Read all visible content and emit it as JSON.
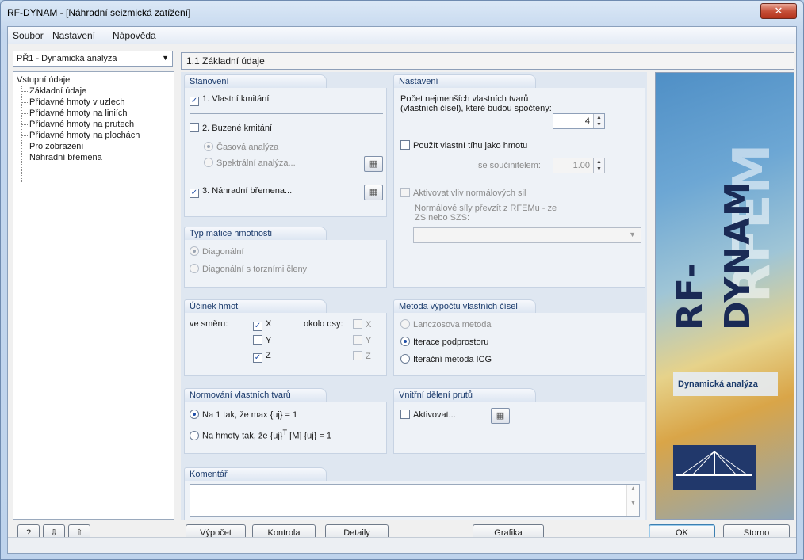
{
  "window": {
    "title": "RF-DYNAM - [Náhradní seizmická zatížení]",
    "close_glyph": "✕"
  },
  "menu": [
    "Soubor",
    "Nastavení",
    "Nápověda"
  ],
  "case_combo": "PŘ1 - Dynamická analýza",
  "tree": {
    "root": "Vstupní údaje",
    "items": [
      "Základní údaje",
      "Přídavné hmoty v uzlech",
      "Přídavné hmoty na liniích",
      "Přídavné hmoty na prutech",
      "Přídavné hmoty na plochách",
      "Pro zobrazení",
      "Náhradní břemena"
    ]
  },
  "section_header": "1.1 Základní údaje",
  "stanoveni": {
    "title": "Stanovení",
    "vlastni_kmitani": "1. Vlastní kmitání",
    "buzene_kmitani": "2. Buzené kmitání",
    "casova": "Časová analýza",
    "spektralni": "Spektrální analýza...",
    "nahradni": "3. Náhradní břemena..."
  },
  "typ_matice": {
    "title": "Typ matice hmotnosti",
    "diagonalni": "Diagonální",
    "diagonalni_torzni": "Diagonální s torzními členy"
  },
  "ucinek": {
    "title": "Účinek hmot",
    "ve_smeru": "ve směru:",
    "okolo_osy": "okolo osy:",
    "x": "X",
    "y": "Y",
    "z": "Z"
  },
  "normovani": {
    "title": "Normování vlastních tvarů",
    "opt1": "Na 1 tak, že max {uj} = 1",
    "opt2_a": "Na hmoty tak, že {uj}",
    "opt2_sup": "T",
    "opt2_b": " [M] {uj} = 1"
  },
  "nastaveni": {
    "title": "Nastavení",
    "pocet_label": "Počet nejmenších vlastních tvarů (vlastních čísel), které budou spočteny:",
    "pocet_value": "4",
    "tihu": "Použít vlastní tíhu jako hmotu",
    "soucinitel_label": "se součinitelem:",
    "soucinitel_value": "1.00",
    "aktivovat_vliv": "Aktivovat vliv normálových sil",
    "normalove_label": "Normálové síly převzít z RFEMu - ze ZS nebo SZS:"
  },
  "metoda": {
    "title": "Metoda výpočtu vlastních čísel",
    "lanczos": "Lanczosova metoda",
    "iterace": "Iterace podprostoru",
    "icg": "Iterační metoda ICG"
  },
  "vnitrni": {
    "title": "Vnitřní dělení prutů",
    "aktivovat": "Aktivovat..."
  },
  "komentar": {
    "title": "Komentář"
  },
  "image_panel": {
    "rf_logo": "RF-DYNAM",
    "rfem_logo": "RFEM",
    "caption": "Dynamická analýza"
  },
  "buttons": {
    "vypocet": "Výpočet",
    "kontrola": "Kontrola",
    "detaily": "Detaily",
    "grafika": "Grafika",
    "ok": "OK",
    "storno": "Storno"
  },
  "colors": {
    "accent": "#1f4ea8",
    "group_title": "#1a3a6b"
  }
}
